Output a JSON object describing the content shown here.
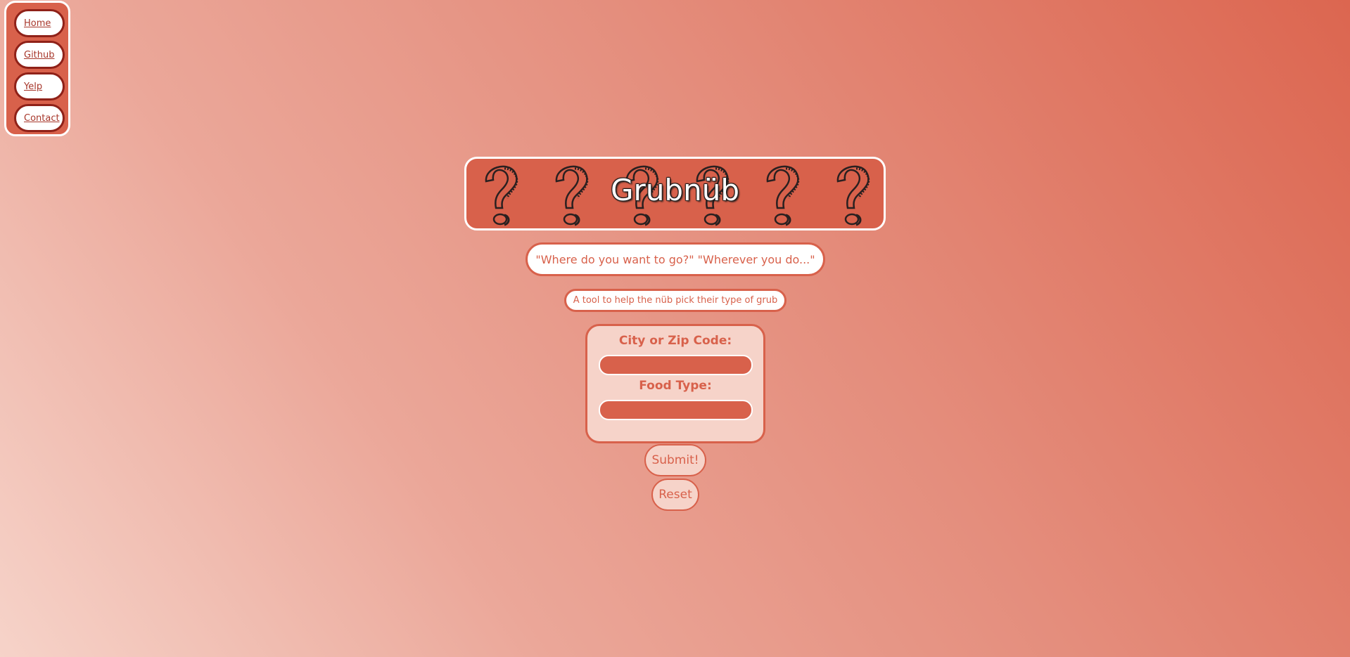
{
  "nav": {
    "items": [
      {
        "label": "Home"
      },
      {
        "label": "Github"
      },
      {
        "label": "Yelp"
      },
      {
        "label": "Contact"
      }
    ]
  },
  "banner": {
    "title": "Grubnüb",
    "icon": "question-mark-icon"
  },
  "quote": "\"Where do you want to go?\" \"Wherever you do...\"",
  "tagline": "A tool to help the nüb pick their type of grub",
  "form": {
    "city_label": "City or Zip Code:",
    "city_value": "",
    "food_label": "Food Type:",
    "food_value": "",
    "submit_label": "Submit!",
    "reset_label": "Reset"
  },
  "colors": {
    "accent": "#d8614b",
    "nav_border": "#8f2118",
    "panel": "#f6d3c9",
    "white": "#ffffff"
  }
}
